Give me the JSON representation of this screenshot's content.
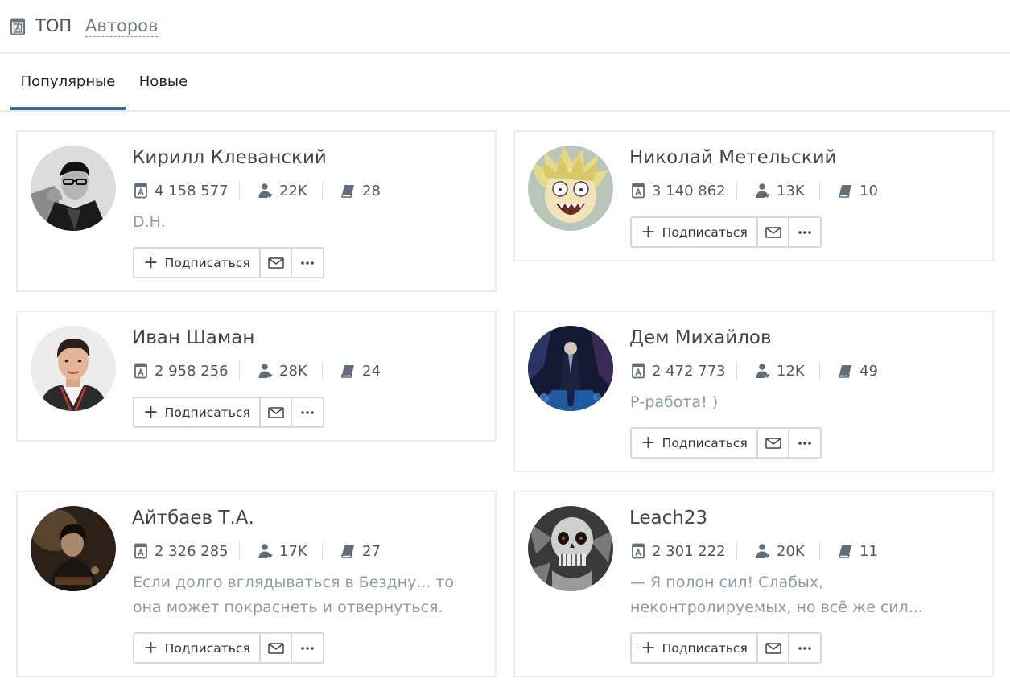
{
  "header": {
    "title": "ТОП",
    "subtitle": "Авторов"
  },
  "tabs": [
    {
      "label": "Популярные",
      "active": true
    },
    {
      "label": "Новые",
      "active": false
    }
  ],
  "buttons": {
    "subscribe": "Подписаться"
  },
  "colors": {
    "tab_underline": "#3a6f8f",
    "status_text": "#8f9ba3",
    "icon": "#5f6e78"
  },
  "authors": [
    {
      "name": "Кирилл Клеванский",
      "rating": "4 158 577",
      "followers": "22K",
      "books": "28",
      "status": "D.H."
    },
    {
      "name": "Николай Метельский",
      "rating": "3 140 862",
      "followers": "13K",
      "books": "10",
      "status": ""
    },
    {
      "name": "Иван Шаман",
      "rating": "2 958 256",
      "followers": "28K",
      "books": "24",
      "status": ""
    },
    {
      "name": "Дем Михайлов",
      "rating": "2 472 773",
      "followers": "12K",
      "books": "49",
      "status": "Р-работа! )"
    },
    {
      "name": "Айтбаев Т.А.",
      "rating": "2 326 285",
      "followers": "17K",
      "books": "27",
      "status": "Если долго вглядываться в Бездну... то она может покраснеть и отвернуться."
    },
    {
      "name": "Leach23",
      "rating": "2 301 222",
      "followers": "20K",
      "books": "11",
      "status": "— Я полон сил! Слабых, неконтролируемых, но всё же сил..."
    }
  ]
}
